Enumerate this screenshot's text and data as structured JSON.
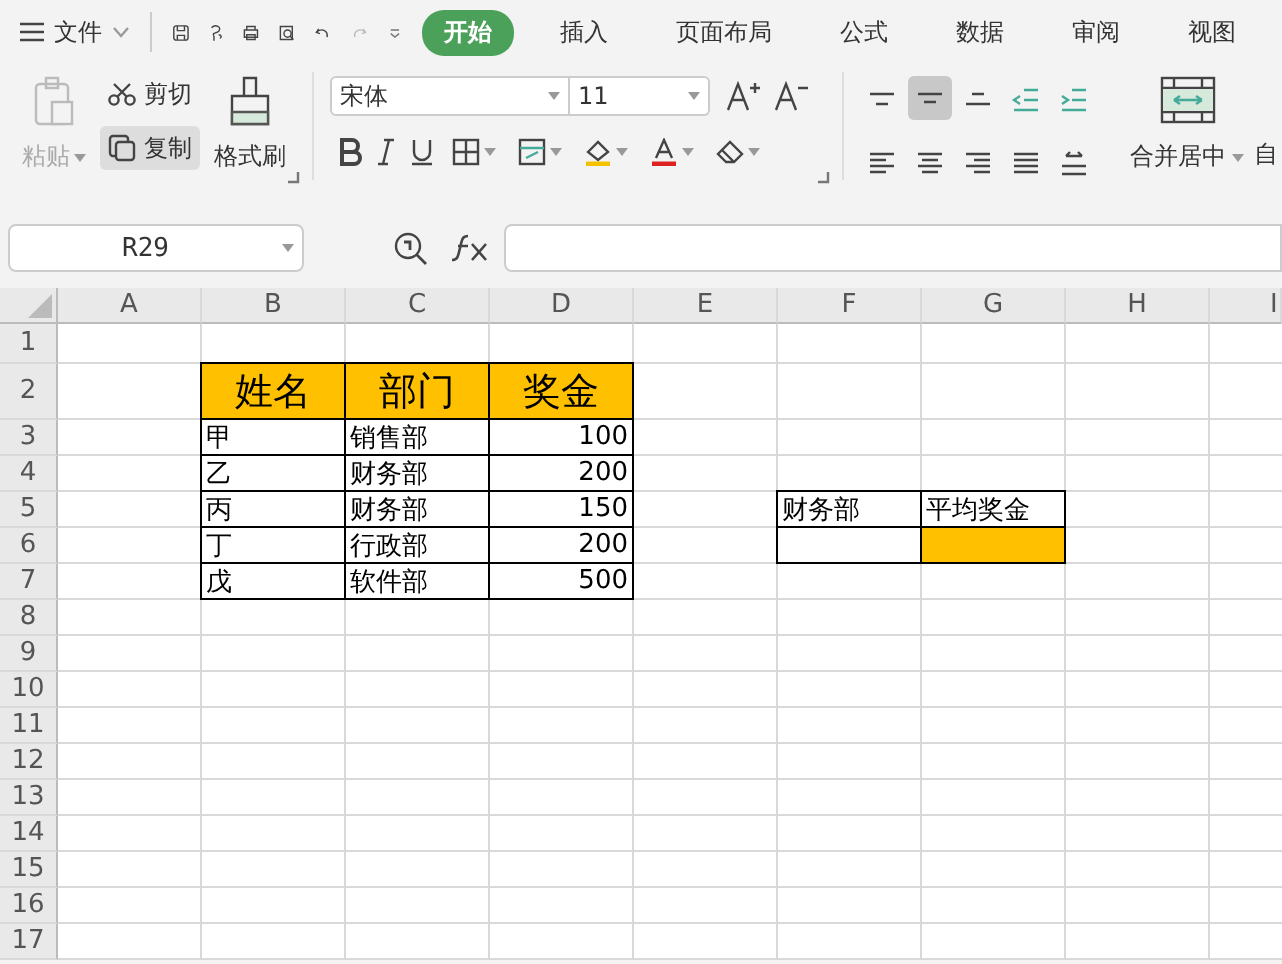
{
  "menu": {
    "label": "文件"
  },
  "tabs": [
    {
      "label": "开始",
      "selected": true
    },
    {
      "label": "插入",
      "selected": false
    },
    {
      "label": "页面布局",
      "selected": false
    },
    {
      "label": "公式",
      "selected": false
    },
    {
      "label": "数据",
      "selected": false
    },
    {
      "label": "审阅",
      "selected": false
    },
    {
      "label": "视图",
      "selected": false
    }
  ],
  "clipboard": {
    "paste": {
      "label": "粘贴",
      "disabled": true
    },
    "cut": {
      "label": "剪切"
    },
    "copy": {
      "label": "复制",
      "pressed": true
    },
    "format_painter": {
      "label": "格式刷"
    }
  },
  "font": {
    "name": "宋体",
    "size": "11"
  },
  "alignment_buttons": [
    {
      "kind": "top",
      "selected": false
    },
    {
      "kind": "middle",
      "selected": true
    },
    {
      "kind": "bottom",
      "selected": false
    },
    {
      "kind": "outdent",
      "selected": false
    },
    {
      "kind": "indent",
      "selected": false
    },
    {
      "kind": "left",
      "selected": false
    },
    {
      "kind": "center",
      "selected": false
    },
    {
      "kind": "right",
      "selected": false
    },
    {
      "kind": "justify",
      "selected": false
    },
    {
      "kind": "distribute",
      "selected": false
    }
  ],
  "merge": {
    "label": "合并居中"
  },
  "next_group_label": "自",
  "formula_bar": {
    "name_box": "R29"
  },
  "sheet": {
    "columns": [
      "A",
      "B",
      "C",
      "D",
      "E",
      "F",
      "G",
      "H",
      "I"
    ],
    "rows": [
      "1",
      "2",
      "3",
      "4",
      "5",
      "6",
      "7",
      "8",
      "9",
      "10",
      "11",
      "12",
      "13",
      "14",
      "15",
      "16",
      "17"
    ],
    "table": {
      "header": [
        "姓名",
        "部门",
        "奖金"
      ],
      "rows": [
        [
          "甲",
          "销售部",
          "100"
        ],
        [
          "乙",
          "财务部",
          "200"
        ],
        [
          "丙",
          "财务部",
          "150"
        ],
        [
          "丁",
          "行政部",
          "200"
        ],
        [
          "戊",
          "软件部",
          "500"
        ]
      ]
    },
    "lookup": {
      "header": [
        "财务部",
        "平均奖金"
      ],
      "result_highlighted": true
    }
  }
}
